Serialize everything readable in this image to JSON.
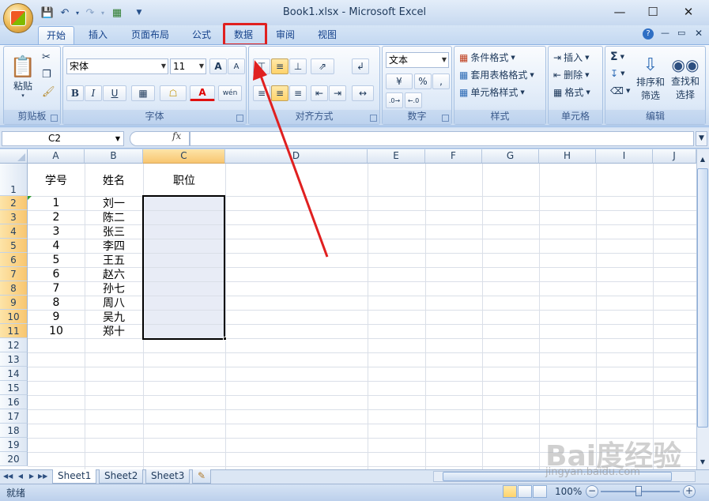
{
  "window": {
    "title": "Book1.xlsx - Microsoft Excel"
  },
  "qat": {
    "save_icon": "save-icon",
    "undo_icon": "undo-icon",
    "redo_icon": "redo-icon"
  },
  "tabs": [
    "开始",
    "插入",
    "页面布局",
    "公式",
    "数据",
    "审阅",
    "视图"
  ],
  "active_tab": "开始",
  "highlighted_tab": "数据",
  "ribbon": {
    "clipboard": {
      "label": "剪贴板",
      "paste": "粘贴"
    },
    "font": {
      "label": "字体",
      "name": "宋体",
      "size": "11",
      "bold": "B",
      "italic": "I",
      "underline": "U",
      "grow": "A",
      "shrink": "A",
      "color": "A",
      "phonetic": "wén"
    },
    "alignment": {
      "label": "对齐方式"
    },
    "number": {
      "label": "数字",
      "format": "文本",
      "percent": "%",
      "comma": ","
    },
    "styles": {
      "label": "样式",
      "conditional": "条件格式",
      "table": "套用表格格式",
      "cell_styles": "单元格样式"
    },
    "cells": {
      "label": "单元格",
      "insert": "插入",
      "delete": "删除",
      "format": "格式"
    },
    "editing": {
      "label": "编辑",
      "sort": "排序和",
      "sort2": "筛选",
      "find": "查找和",
      "find2": "选择",
      "sum": "Σ"
    }
  },
  "formula_bar": {
    "name_box": "C2",
    "fx": "fx",
    "value": ""
  },
  "columns": [
    "A",
    "B",
    "C",
    "D",
    "E",
    "F",
    "G",
    "H",
    "I",
    "J"
  ],
  "rows": [
    "1",
    "2",
    "3",
    "4",
    "5",
    "6",
    "7",
    "8",
    "9",
    "10",
    "11",
    "12",
    "13",
    "14",
    "15",
    "16",
    "17",
    "18",
    "19",
    "20"
  ],
  "cells": {
    "A1": "学号",
    "B1": "姓名",
    "C1": "职位",
    "A": [
      "1",
      "2",
      "3",
      "4",
      "5",
      "6",
      "7",
      "8",
      "9",
      "10"
    ],
    "B": [
      "刘一",
      "陈二",
      "张三",
      "李四",
      "王五",
      "赵六",
      "孙七",
      "周八",
      "吴九",
      "郑十"
    ]
  },
  "sheets": [
    "Sheet1",
    "Sheet2",
    "Sheet3"
  ],
  "active_sheet": "Sheet1",
  "status": {
    "text": "就绪",
    "zoom": "100%",
    "zoom_fraction": 0.5
  },
  "watermark": {
    "main": "Bai度经验",
    "sub": "jingyan.baidu.com"
  },
  "colors": {
    "highlight": "#e02020",
    "arrow": "#e02020",
    "selection": "#e8ecf6"
  }
}
